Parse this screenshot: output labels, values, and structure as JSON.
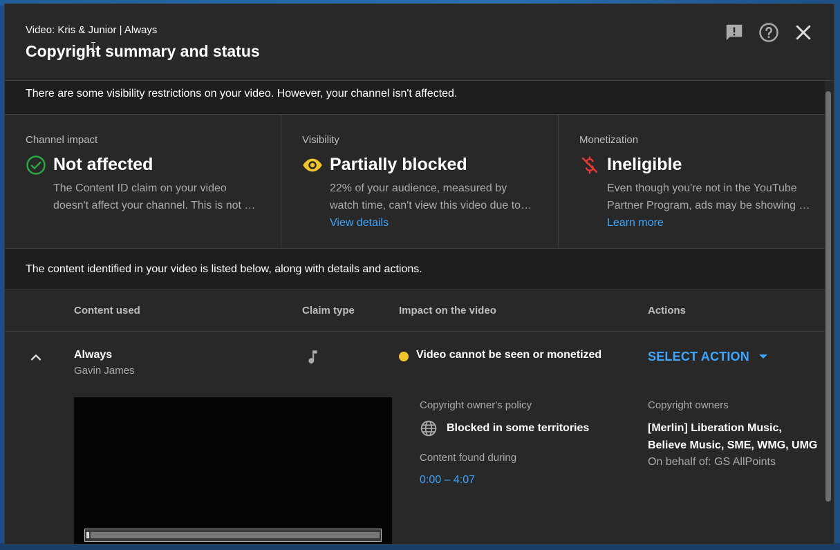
{
  "header": {
    "video_label": "Video: Kris & Junior | Always",
    "title": "Copyright summary and status",
    "icons": [
      "feedback-icon",
      "help-icon",
      "close-icon"
    ]
  },
  "banner_top": "There are some visibility restrictions on your video. However, your channel isn't affected.",
  "cards": [
    {
      "label": "Channel impact",
      "icon": "check-circle-icon",
      "icon_color": "#2ba640",
      "status": "Not affected",
      "desc_lines": [
        "The Content ID claim on your video",
        "doesn't affect your channel. This is not …"
      ],
      "link": ""
    },
    {
      "label": "Visibility",
      "icon": "eye-icon",
      "icon_color": "#f2c42b",
      "status": "Partially blocked",
      "desc_lines": [
        "22% of your audience, measured by",
        "watch time, can't view this video due to…"
      ],
      "link": "View details"
    },
    {
      "label": "Monetization",
      "icon": "no-money-icon",
      "icon_color": "#e53935",
      "status": "Ineligible",
      "desc_lines": [
        "Even though you're not in the YouTube",
        "Partner Program, ads may be showing o…"
      ],
      "link": "Learn more"
    }
  ],
  "banner_content": "The content identified in your video is listed below, along with details and actions.",
  "table": {
    "headers": [
      "Content used",
      "Claim type",
      "Impact on the video",
      "Actions"
    ],
    "row": {
      "title": "Always",
      "artist": "Gavin James",
      "claim_type_icon": "music-note-icon",
      "impact": "Video cannot be seen or monetized",
      "impact_color": "#f2c42b",
      "action": "SELECT ACTION"
    }
  },
  "details": {
    "policy_label": "Copyright owner's policy",
    "policy_value": "Blocked in some territories",
    "found_label": "Content found during",
    "found_value": "0:00 – 4:07",
    "owners_label": "Copyright owners",
    "owners_value": "[Merlin] Liberation Music, Believe Music, SME, WMG, UMG",
    "behalf": "On behalf of: GS AllPoints"
  },
  "colors": {
    "accent_link": "#3ea6ff",
    "dialog_bg": "#282828"
  }
}
